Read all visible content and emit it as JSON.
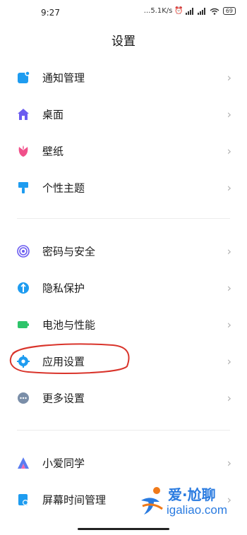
{
  "status_bar": {
    "time": "9:27",
    "network_speed": "...5.1K/s",
    "battery": "69"
  },
  "header": {
    "title": "设置"
  },
  "groups": [
    {
      "items": [
        {
          "label": "通知管理",
          "icon": "notification-icon",
          "color": "#1e9cf0"
        },
        {
          "label": "桌面",
          "icon": "home-icon",
          "color": "#6b5cf0"
        },
        {
          "label": "壁纸",
          "icon": "tulip-icon",
          "color": "#f0508a"
        },
        {
          "label": "个性主题",
          "icon": "brush-icon",
          "color": "#1e9cf0"
        }
      ]
    },
    {
      "items": [
        {
          "label": "密码与安全",
          "icon": "fingerprint-icon",
          "color": "#6b5cf0"
        },
        {
          "label": "隐私保护",
          "icon": "shield-icon",
          "color": "#1e9cf0"
        },
        {
          "label": "电池与性能",
          "icon": "battery-icon",
          "color": "#2ec46a"
        },
        {
          "label": "应用设置",
          "icon": "gear-icon",
          "color": "#1e9cf0"
        },
        {
          "label": "更多设置",
          "icon": "more-icon",
          "color": "#7a8ea8"
        }
      ]
    },
    {
      "items": [
        {
          "label": "小爱同学",
          "icon": "xiaoai-icon",
          "color": "#5a7cf0"
        },
        {
          "label": "屏幕时间管理",
          "icon": "screen-time-icon",
          "color": "#1e9cf0"
        }
      ]
    }
  ],
  "annotation": {
    "color": "#d9342b"
  },
  "watermark": {
    "line1": "爱·尬聊",
    "line2": "igaliao.com",
    "color": "#2a7be0",
    "accent": "#f07a1a"
  }
}
